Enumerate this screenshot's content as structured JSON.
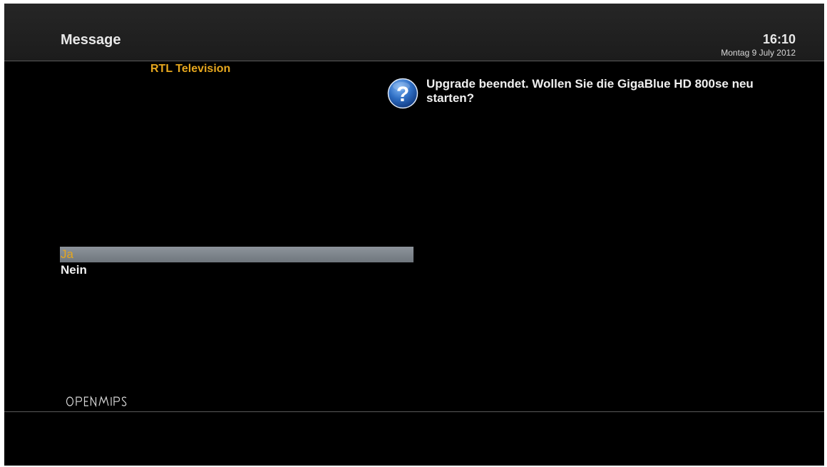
{
  "header": {
    "title": "Message",
    "time": "16:10",
    "date": "Montag 9 July 2012"
  },
  "channel": {
    "name": "RTL Television"
  },
  "dialog": {
    "icon": "question-icon",
    "message": "Upgrade beendet. Wollen Sie die GigaBlue HD 800se neu starten?",
    "choices": [
      {
        "label": "Ja",
        "selected": true
      },
      {
        "label": "Nein",
        "selected": false
      }
    ]
  },
  "branding": {
    "logo_text": "OPENMIPS"
  },
  "colors": {
    "background": "#000000",
    "accent": "#e6a71e",
    "selection": "#7d848b",
    "icon": "#2f6fc4"
  }
}
